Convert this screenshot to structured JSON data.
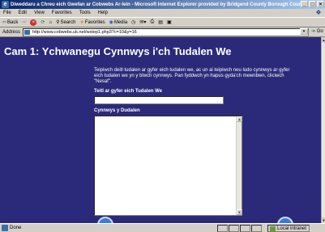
{
  "window": {
    "title": "Diweddaru a Chreu eich Gwefan ar Cobwebs Ar-lein - Microsoft Internet Explorer provided by Bridgend County Borough Council"
  },
  "menu": {
    "items": [
      "File",
      "Edit",
      "View",
      "Favorites",
      "Tools",
      "Help"
    ]
  },
  "toolbar": {
    "back_label": "Back",
    "search_label": "Search",
    "favorites_label": "Favorites",
    "media_label": "Media"
  },
  "address": {
    "label": "Address",
    "url": "http://www.cobwebs.uk.net/wstep1.php3?c=10&y=16",
    "go_label": "Go"
  },
  "page": {
    "heading": "Cam 1: Ychwanegu Cynnwys i'ch Tudalen We",
    "intro": "Teipiwch deitl tudalen ar gyfer eich tudalen we, ac un ai teipiwch neu ludo cynnwys ar gyfer eich tudalen we yn y blwch cynnwys. Pan fyddwch yn hapus gyda'ch mewnbwn, cliciwch \"Nesaf\".",
    "title_label": "Teitl ar gyfer eich Tudalen We",
    "title_value": "",
    "content_label": "Cynnwys y Dudalen",
    "content_value": ""
  },
  "status": {
    "text": "Done",
    "zone": "Local intranet"
  }
}
